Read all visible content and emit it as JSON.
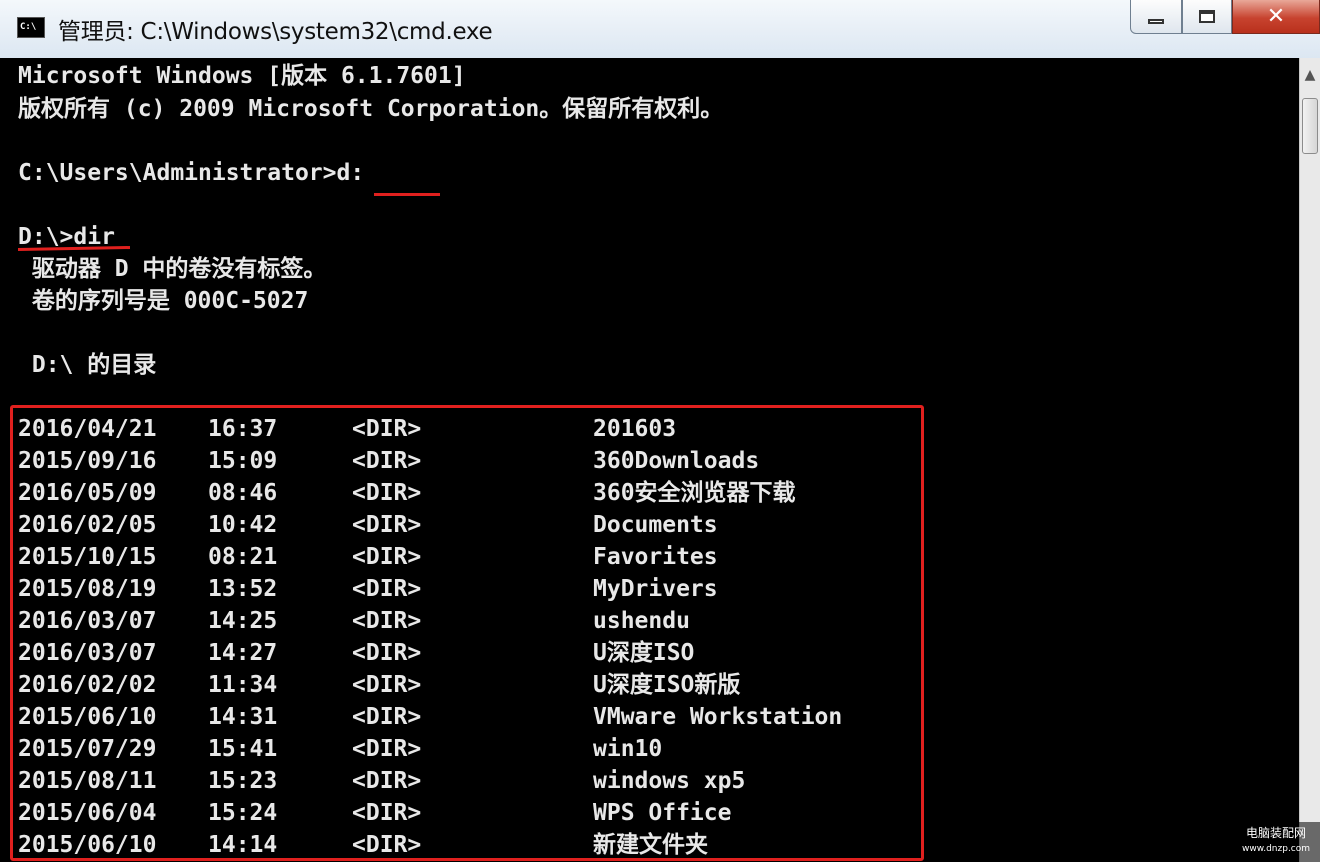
{
  "window": {
    "title": "管理员: C:\\Windows\\system32\\cmd.exe",
    "icon_text": "C:\\",
    "buttons": {
      "minimize": "minimize-icon",
      "maximize": "maximize-icon",
      "close": "✕"
    }
  },
  "console": {
    "header_line1": "Microsoft Windows [版本 6.1.7601]",
    "header_line2": "版权所有 (c) 2009 Microsoft Corporation。保留所有权利。",
    "prompt1": "C:\\Users\\Administrator>d:",
    "prompt2": "D:\\>dir",
    "volume_label": " 驱动器 D 中的卷没有标签。",
    "volume_serial": " 卷的序列号是 000C-5027",
    "directory_of": " D:\\ 的目录",
    "entries": [
      {
        "date": "2016/04/21",
        "time": "16:37",
        "type": "<DIR>",
        "name": "201603"
      },
      {
        "date": "2015/09/16",
        "time": "15:09",
        "type": "<DIR>",
        "name": "360Downloads"
      },
      {
        "date": "2016/05/09",
        "time": "08:46",
        "type": "<DIR>",
        "name": "360安全浏览器下载"
      },
      {
        "date": "2016/02/05",
        "time": "10:42",
        "type": "<DIR>",
        "name": "Documents"
      },
      {
        "date": "2015/10/15",
        "time": "08:21",
        "type": "<DIR>",
        "name": "Favorites"
      },
      {
        "date": "2015/08/19",
        "time": "13:52",
        "type": "<DIR>",
        "name": "MyDrivers"
      },
      {
        "date": "2016/03/07",
        "time": "14:25",
        "type": "<DIR>",
        "name": "ushendu"
      },
      {
        "date": "2016/03/07",
        "time": "14:27",
        "type": "<DIR>",
        "name": "U深度ISO"
      },
      {
        "date": "2016/02/02",
        "time": "11:34",
        "type": "<DIR>",
        "name": "U深度ISO新版"
      },
      {
        "date": "2015/06/10",
        "time": "14:31",
        "type": "<DIR>",
        "name": "VMware Workstation"
      },
      {
        "date": "2015/07/29",
        "time": "15:41",
        "type": "<DIR>",
        "name": "win10"
      },
      {
        "date": "2015/08/11",
        "time": "15:23",
        "type": "<DIR>",
        "name": "windows xp5"
      },
      {
        "date": "2015/06/04",
        "time": "15:24",
        "type": "<DIR>",
        "name": "WPS Office"
      },
      {
        "date": "2015/06/10",
        "time": "14:14",
        "type": "<DIR>",
        "name": "新建文件夹"
      }
    ]
  },
  "watermark": {
    "line1": "电脑装配网",
    "line2": "www.dnzp.com"
  },
  "colors": {
    "console_bg": "#000000",
    "console_text": "#e8e8e8",
    "annotation_red": "#e0201e",
    "close_button": "#c7432f"
  }
}
